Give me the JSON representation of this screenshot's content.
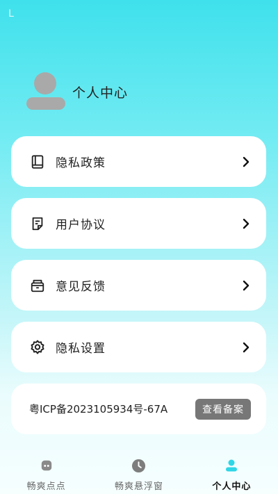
{
  "status": {
    "mark": "L"
  },
  "profile": {
    "title": "个人中心"
  },
  "menu": [
    {
      "label": "隐私政策",
      "icon": "book-icon"
    },
    {
      "label": "用户协议",
      "icon": "document-icon"
    },
    {
      "label": "意见反馈",
      "icon": "feedback-box-icon"
    },
    {
      "label": "隐私设置",
      "icon": "gear-icon"
    }
  ],
  "icp": {
    "text": "粤ICP备2023105934号-67A",
    "button": "查看备案"
  },
  "tabs": [
    {
      "label": "畅爽点点",
      "icon": "home-icon",
      "active": false
    },
    {
      "label": "畅爽悬浮窗",
      "icon": "clock-icon",
      "active": false
    },
    {
      "label": "个人中心",
      "icon": "person-icon",
      "active": true
    }
  ],
  "colors": {
    "accent": "#2ed6e6",
    "record_button": "#777777",
    "avatar": "#a9a9a9"
  }
}
